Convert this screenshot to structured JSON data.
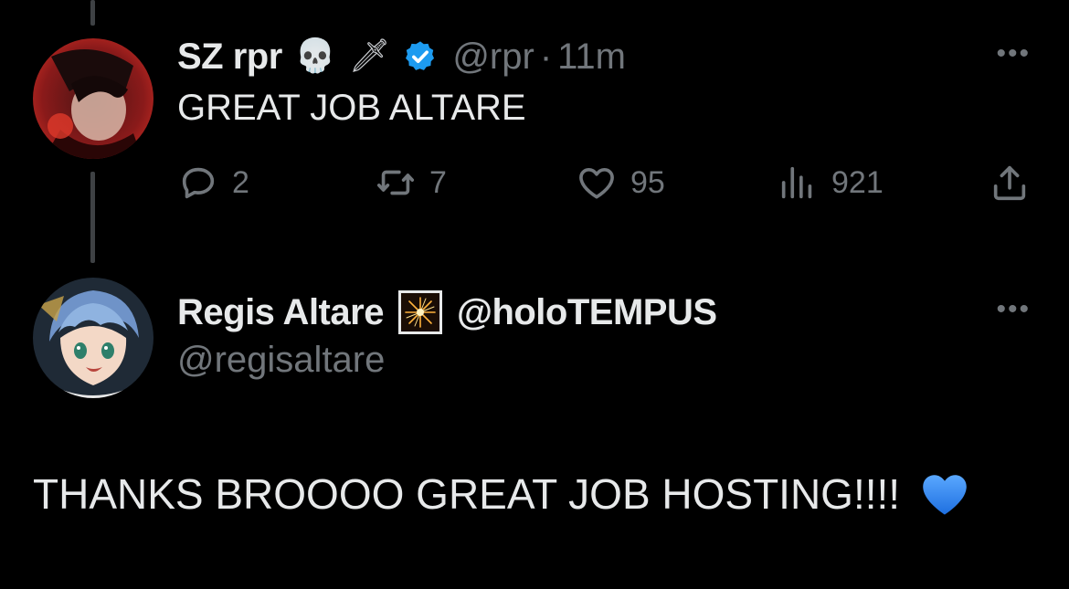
{
  "tweet": {
    "display_name": "SZ rpr",
    "emojis": [
      "💀",
      "🗡"
    ],
    "handle": "@rpr",
    "separator": "·",
    "time": "11m",
    "text": "GREAT JOB ALTARE",
    "more_label": "•••",
    "stats": {
      "replies": "2",
      "retweets": "7",
      "likes": "95",
      "views": "921"
    },
    "icons": [
      "reply-icon",
      "retweet-icon",
      "like-icon",
      "views-icon",
      "share-icon"
    ]
  },
  "reply": {
    "display_name": "Regis Altare",
    "emoji": "🎇",
    "affiliation": "@holoTEMPUS",
    "handle": "@regisaltare",
    "more_label": "•••",
    "text": "THANKS BROOOO GREAT JOB HOSTING!!!!",
    "trailing_emoji": "💙"
  },
  "colors": {
    "background": "#000000",
    "text": "#e7e9ea",
    "secondary": "#71767b",
    "verified": "#1d9bf0",
    "thread_line": "#3e4144"
  }
}
